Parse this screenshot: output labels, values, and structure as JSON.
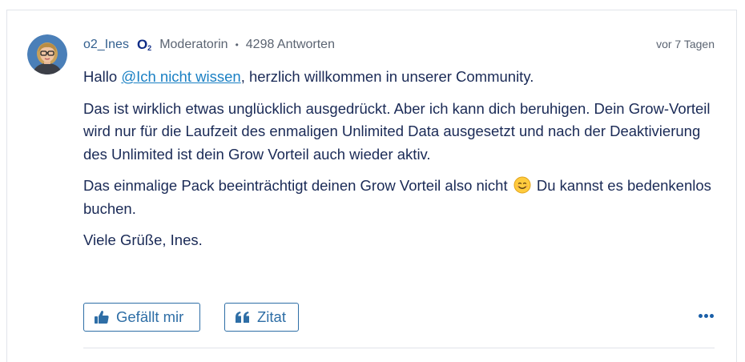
{
  "post": {
    "author": {
      "username": "o2_Ines",
      "badge_brand": "O",
      "badge_sub": "2",
      "role": "Moderatorin",
      "separator": "•",
      "answer_count": "4298 Antworten"
    },
    "timestamp": "vor 7 Tagen",
    "body": {
      "greeting_prefix": "Hallo ",
      "mention": "@Ich nicht wissen",
      "greeting_suffix": ", herzlich willkommen in unserer Community.",
      "paragraph_2": "Das ist wirklich etwas unglücklich ausgedrückt. Aber ich kann dich beruhigen. Dein Grow-Vorteil wird nur für die Laufzeit des enmaligen Unlimited Data ausgesetzt und nach der Deaktivierung des Unlimited ist dein Grow Vorteil auch wieder aktiv.",
      "paragraph_3_before_emoji": "Das einmalige Pack beeinträchtigt deinen Grow Vorteil also nicht ",
      "paragraph_3_after_emoji": " Du kannst es bedenkenlos buchen.",
      "signoff": "Viele Grüße, Ines."
    },
    "actions": {
      "like_label": "Gefällt mir",
      "quote_label": "Zitat"
    },
    "icons": {
      "avatar": "user-avatar",
      "like": "thumbs-up-icon",
      "quote": "quote-icon",
      "emoji": "smiling-face-emoji",
      "more": "more-options-icon"
    },
    "colors": {
      "brand_navy": "#0f2c86",
      "text": "#1a2a56",
      "link": "#1a80c4",
      "button": "#2e6ea6",
      "muted": "#5b6472"
    }
  }
}
